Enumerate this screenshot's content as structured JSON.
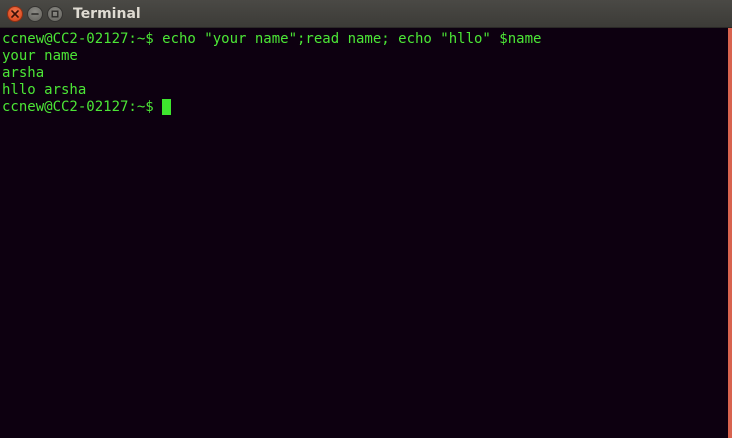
{
  "window": {
    "title": "Terminal"
  },
  "titlebar": {
    "close_icon": "close-icon",
    "minimize_icon": "minimize-icon",
    "maximize_icon": "maximize-icon"
  },
  "terminal": {
    "lines": [
      "ccnew@CC2-02127:~$ echo \"your name\";read name; echo \"hllo\" $name",
      "your name",
      "arsha",
      "hllo arsha"
    ],
    "prompt": "ccnew@CC2-02127:~$ "
  },
  "colors": {
    "background": "#0d0010",
    "text": "#4ce636",
    "cursor": "#3ee62e",
    "titlebar": "#3c3b37",
    "title_text": "#dfdbd2",
    "close_button": "#e0552a",
    "right_edge": "#d8634f"
  }
}
